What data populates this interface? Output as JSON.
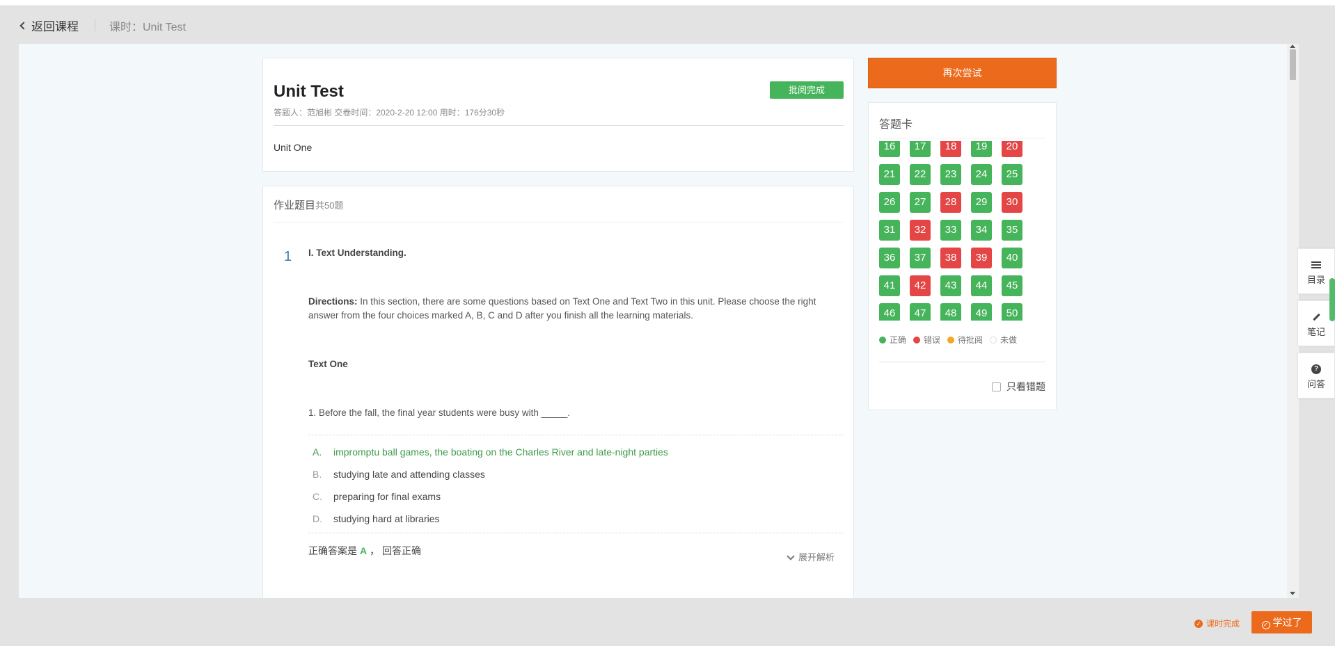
{
  "header": {
    "back_label": "返回课程",
    "lesson_label": "课时：Unit Test"
  },
  "exam": {
    "title": "Unit Test",
    "status": "批阅完成",
    "meta": "答题人：范旭彬 交卷时间：2020-2-20 12:00 用时：176分30秒",
    "unit": "Unit One"
  },
  "questions": {
    "heading": "作业题目",
    "count": "共50题",
    "number": "1",
    "section": "I. Text Understanding.",
    "directions_label": "Directions:",
    "directions_text": " In this section, there are some questions based on Text One and Text Two in this unit. Please choose the right answer from the four choices marked A, B, C and D after you finish all the learning materials.",
    "text_title": "Text One",
    "stem": "1. Before the fall, the final year students were busy with _____.",
    "options": [
      {
        "letter": "A.",
        "text": "impromptu ball games, the boating on the Charles River and late-night parties"
      },
      {
        "letter": "B.",
        "text": "studying late and attending classes"
      },
      {
        "letter": "C.",
        "text": "preparing for final exams"
      },
      {
        "letter": "D.",
        "text": "studying hard at libraries"
      }
    ],
    "result_prefix": "正确答案是",
    "result_answer": "A",
    "result_suffix": "， 回答正确",
    "expand_label": "展开解析"
  },
  "answer_card": {
    "retry_label": "再次尝试",
    "title": "答题卡",
    "cells": [
      {
        "n": "16",
        "s": "ok"
      },
      {
        "n": "17",
        "s": "ok"
      },
      {
        "n": "18",
        "s": "bad"
      },
      {
        "n": "19",
        "s": "ok"
      },
      {
        "n": "20",
        "s": "bad"
      },
      {
        "n": "21",
        "s": "ok"
      },
      {
        "n": "22",
        "s": "ok"
      },
      {
        "n": "23",
        "s": "ok"
      },
      {
        "n": "24",
        "s": "ok"
      },
      {
        "n": "25",
        "s": "ok"
      },
      {
        "n": "26",
        "s": "ok"
      },
      {
        "n": "27",
        "s": "ok"
      },
      {
        "n": "28",
        "s": "bad"
      },
      {
        "n": "29",
        "s": "ok"
      },
      {
        "n": "30",
        "s": "bad"
      },
      {
        "n": "31",
        "s": "ok"
      },
      {
        "n": "32",
        "s": "bad"
      },
      {
        "n": "33",
        "s": "ok"
      },
      {
        "n": "34",
        "s": "ok"
      },
      {
        "n": "35",
        "s": "ok"
      },
      {
        "n": "36",
        "s": "ok"
      },
      {
        "n": "37",
        "s": "ok"
      },
      {
        "n": "38",
        "s": "bad"
      },
      {
        "n": "39",
        "s": "bad"
      },
      {
        "n": "40",
        "s": "ok"
      },
      {
        "n": "41",
        "s": "ok"
      },
      {
        "n": "42",
        "s": "bad"
      },
      {
        "n": "43",
        "s": "ok"
      },
      {
        "n": "44",
        "s": "ok"
      },
      {
        "n": "45",
        "s": "ok"
      },
      {
        "n": "46",
        "s": "ok"
      },
      {
        "n": "47",
        "s": "ok"
      },
      {
        "n": "48",
        "s": "ok"
      },
      {
        "n": "49",
        "s": "ok"
      },
      {
        "n": "50",
        "s": "ok"
      }
    ],
    "legend": [
      {
        "label": "正确",
        "color": "#45b45a"
      },
      {
        "label": "错误",
        "color": "#e44545"
      },
      {
        "label": "待批阅",
        "color": "#f5a623"
      },
      {
        "label": "未做",
        "color": "#ffffff"
      }
    ],
    "only_wrong_label": "只看错题"
  },
  "side_tools": {
    "catalog": "目录",
    "notes": "笔记",
    "qa": "问答"
  },
  "footer": {
    "status": "课时完成",
    "learned": "学过了"
  },
  "colors": {
    "correct": "#45b45a",
    "wrong": "#e44545",
    "accent": "#ec6a1c",
    "number_blue": "#3a79b5"
  }
}
